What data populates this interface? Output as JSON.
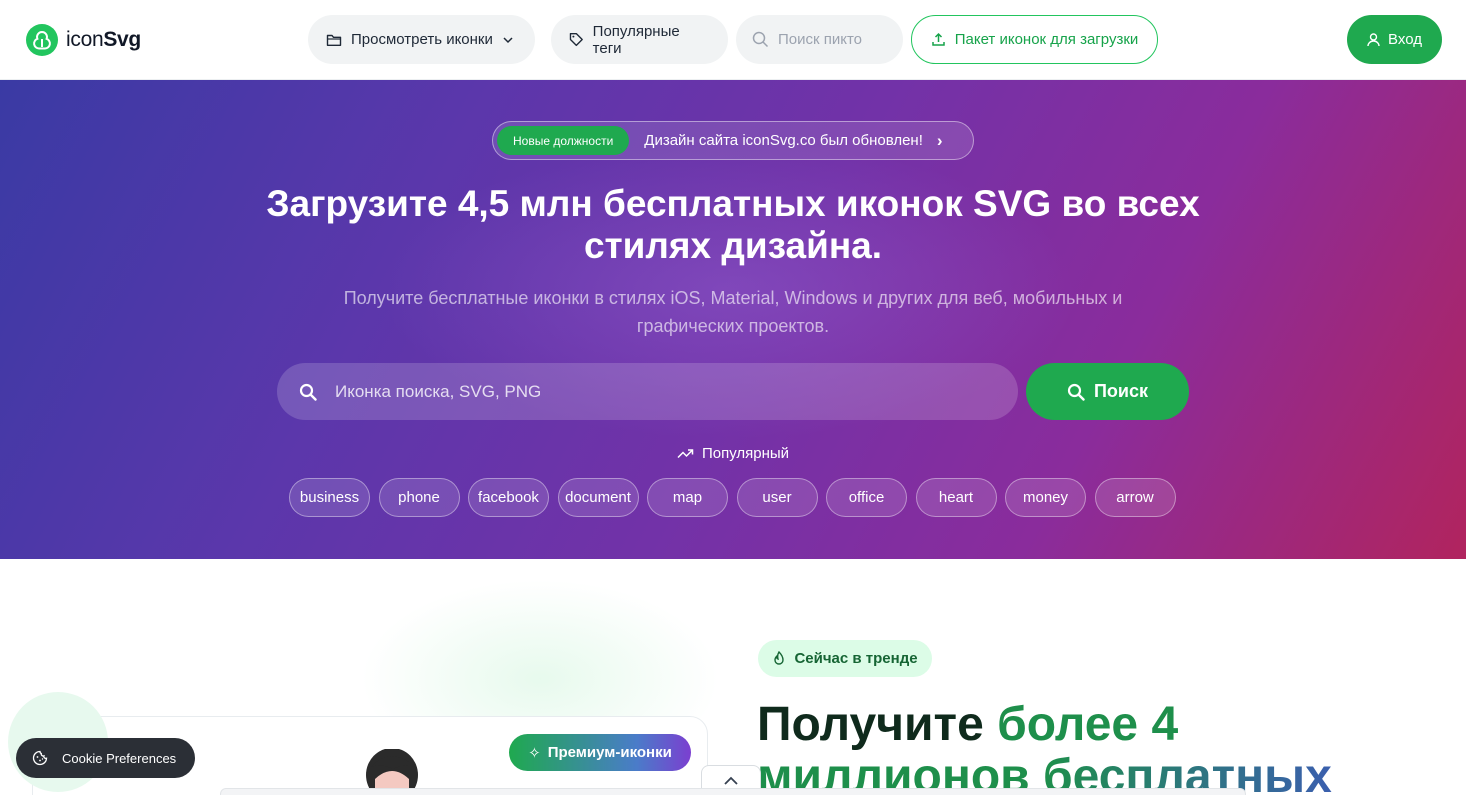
{
  "logo": {
    "text_light": "icon",
    "text_bold": "Svg"
  },
  "nav": {
    "browse_label": "Просмотреть иконки",
    "tags_label": "Популярные теги",
    "search_placeholder": "Поиск пикто",
    "pack_label": "Пакет иконок для загрузки",
    "login_label": "Вход"
  },
  "hero": {
    "announce_badge": "Новые должности",
    "announce_text": "Дизайн сайта iconSvg.co был обновлен!",
    "title_line1": "Загрузите 4,5 млн бесплатных иконок SVG во всех",
    "title_line2": "стилях дизайна.",
    "subtitle_line1": "Получите бесплатные иконки в стилях iOS, Material, Windows и других для веб, мобильных и",
    "subtitle_line2": "графических проектов.",
    "search_placeholder": "Иконка поиска, SVG, PNG",
    "search_button": "Поиск",
    "popular_label": "Популярный",
    "tags": [
      "business",
      "phone",
      "facebook",
      "document",
      "map",
      "user",
      "office",
      "heart",
      "money",
      "arrow"
    ]
  },
  "lower": {
    "trend_badge": "Сейчас в тренде",
    "title_dark": "Получите ",
    "title_green": "более 4",
    "title_line2_green": "миллионов ",
    "title_line2_grad": "бесплатных",
    "premium_badge": "Премиум-иконки"
  },
  "cookie": {
    "label": "Cookie Preferences"
  },
  "colors": {
    "accent": "#1fa94f",
    "hero_start": "#3a3aa4",
    "hero_end": "#b1245e"
  }
}
